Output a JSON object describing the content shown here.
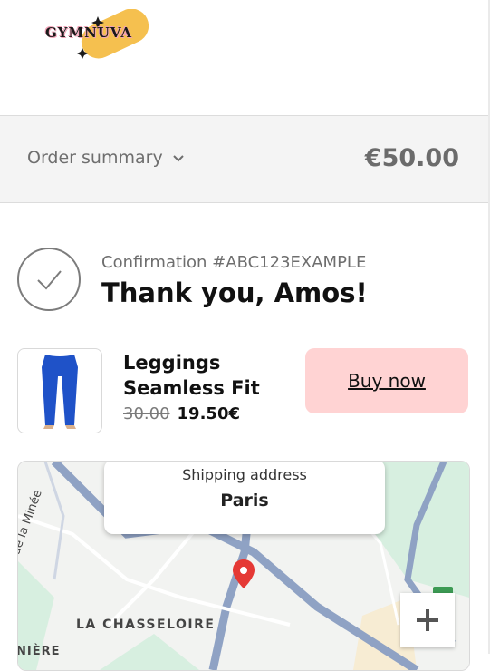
{
  "brand": {
    "logo_text": "GYMNUVA",
    "accent": "#f5c04f",
    "accent_secondary": "#f2a1b7"
  },
  "order_summary": {
    "label": "Order summary",
    "total": "€50.00",
    "toggle_icon": "chevron-down-icon"
  },
  "confirmation": {
    "number_label": "Confirmation #ABC123EXAMPLE",
    "thank_you": "Thank you, Amos!",
    "icon": "checkmark-circle-icon"
  },
  "product": {
    "name": "Leggings Seamless Fit",
    "old_price": "30.00",
    "new_price": "19.50€",
    "image_icon": "leggings-image",
    "image_color": "#1f52c8"
  },
  "buy_button": {
    "label": "Buy now",
    "color": "#ffd3d3"
  },
  "shipping": {
    "label": "Shipping address",
    "city": "Paris"
  },
  "map": {
    "place_labels": [
      "LA CHASSELOIRE",
      "de la Minée",
      "NIÈRE"
    ],
    "zoom_in_icon": "plus-icon",
    "pin_icon": "map-pin-icon",
    "pin_color": "#e53935"
  }
}
